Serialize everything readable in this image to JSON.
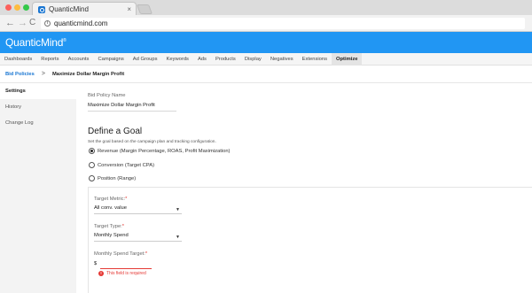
{
  "browser": {
    "tab_title": "QuanticMind",
    "tab_close": "×",
    "url": "quanticmind.com",
    "back_icon": "←",
    "forward_icon": "→",
    "reload_icon": "C",
    "info_icon": "i"
  },
  "app": {
    "logo_text": "QuanticMind",
    "logo_mark": "®",
    "accent_color": "#2196f3"
  },
  "nav": {
    "items": [
      "Dashboards",
      "Reports",
      "Accounts",
      "Campaigns",
      "Ad Groups",
      "Keywords",
      "Ads",
      "Products",
      "Display",
      "Negatives",
      "Extensions",
      "Optimize"
    ],
    "active": "Optimize"
  },
  "breadcrumb": {
    "parent": "Bid Policies",
    "separator": ">",
    "current": "Maximize Dollar Margin Profit"
  },
  "sidebar": {
    "items": [
      "Settings",
      "History",
      "Change Log"
    ]
  },
  "form": {
    "policy_name_label": "Bid Policy Name",
    "policy_name_value": "Maximize Dollar Margin Profit",
    "goal_title": "Define a Goal",
    "goal_desc": "Set the goal based on the campaign plan and tracking configuration.",
    "goal_options": [
      {
        "label": "Revenue (Margin Percentage, ROAS, Profit Maximization)",
        "checked": true
      },
      {
        "label": "Conversion (Target CPA)",
        "checked": false
      },
      {
        "label": "Position (Range)",
        "checked": false
      }
    ],
    "target_metric_label": "Target Metric:",
    "target_metric_value": "All conv. value",
    "target_type_label": "Target Type:",
    "target_type_value": "Monthly Spend",
    "monthly_spend_label": "Monthly Spend Target:",
    "monthly_spend_prefix": "$",
    "required_mark": "*",
    "dropdown_icon": "▼",
    "error_icon": "!",
    "error_text": "This field is required",
    "error_color": "#e53935"
  }
}
